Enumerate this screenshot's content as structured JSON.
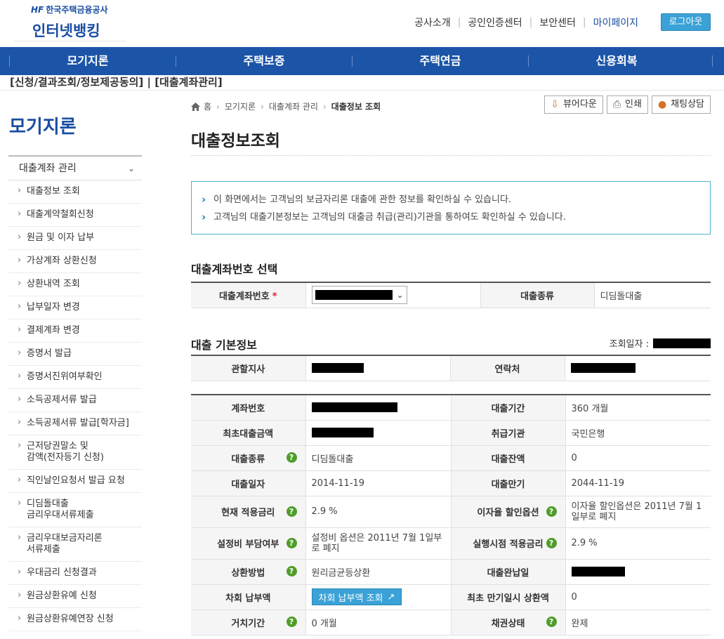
{
  "header": {
    "logo_mark": "HF",
    "logo_small": "한국주택금융공사",
    "logo_big": "인터넷뱅킹",
    "util_links": [
      "공사소개",
      "공인인증센터",
      "보안센터",
      "마이페이지"
    ],
    "logout": "로그아웃"
  },
  "gnb": [
    "모기지론",
    "주택보증",
    "주택연금",
    "신용회복"
  ],
  "top_crumb": "[신청/결과조회/정보제공동의] | [대출계좌관리]",
  "lnb": {
    "title": "모기지론",
    "group": "대출계좌 관리",
    "items": [
      "대출정보 조회",
      "대출계약철회신청",
      "원금 및 이자 납부",
      "가상계좌 상환신청",
      "상환내역 조회",
      "납부일자 변경",
      "결제계좌 변경",
      "증명서 발급",
      "증명서진위여부확인",
      "소득공제서류 발급",
      "소득공제서류 발급[학자금]",
      "근저당권말소 및\n감액(전자등기 신청)",
      "직인날인요청서 발급 요청",
      "디딤돌대출\n금리우대서류제출",
      "금리우대보금자리론\n서류제출",
      "우대금리 신청결과",
      "원금상환유예 신청",
      "원금상환유예연장 신청"
    ]
  },
  "breadcrumb": [
    "홈",
    "모기지론",
    "대출계좌 관리",
    "대출정보 조회"
  ],
  "tools": [
    "뷰어다운",
    "인쇄",
    "채팅상담"
  ],
  "page_title": "대출정보조회",
  "info": [
    "이 화면에서는 고객님의 보금자리론 대출에 관한 정보를 확인하실 수 있습니다.",
    "고객님의 대출기본정보는 고객님의 대출금 취급(관리)기관을 통하여도 확인하실 수 있습니다."
  ],
  "select_section": {
    "title": "대출계좌번호 선택",
    "account_label": "대출계좌번호",
    "required_mark": "*",
    "type_label": "대출종류",
    "type_value": "디딤돌대출"
  },
  "basic_section": {
    "title": "대출 기본정보",
    "query_date_label": "조회일자 :",
    "branch_label": "관할지사",
    "contact_label": "연락처"
  },
  "details": {
    "account_no": "계좌번호",
    "loan_period": "대출기간",
    "loan_period_value": "360 개월",
    "initial_amount": "최초대출금액",
    "handler": "취급기관",
    "handler_value": "국민은행",
    "loan_type": "대출종류",
    "loan_type_value": "디딤돌대출",
    "balance": "대출잔액",
    "balance_value": "0",
    "loan_date": "대출일자",
    "loan_date_value": "2014-11-19",
    "maturity": "대출만기",
    "maturity_value": "2044-11-19",
    "current_rate": "현재 적용금리",
    "current_rate_value": "2.9  %",
    "discount_option": "이자율 할인옵션",
    "discount_option_value": "이자율 할인옵션은 2011년 7월 1일부로 폐지",
    "setup_cost": "설정비 부담여부",
    "setup_cost_value": "설정비 옵션은 2011년 7월 1일부로 폐지",
    "exec_rate": "실행시점 적용금리",
    "exec_rate_value": "2.9  %",
    "repay_method": "상환방법",
    "repay_method_value": "원리금균등상환",
    "complete_date": "대출완납일",
    "next_payment": "차회 납부액",
    "next_payment_btn": "차회 납부액 조회",
    "initial_maturity_repay": "최초 만기일시 상환액",
    "initial_maturity_repay_value": "0",
    "grace": "거치기간",
    "grace_value": "0 개월",
    "bond_status": "채권상태",
    "bond_status_value": "완제"
  },
  "help_glyph": "?"
}
